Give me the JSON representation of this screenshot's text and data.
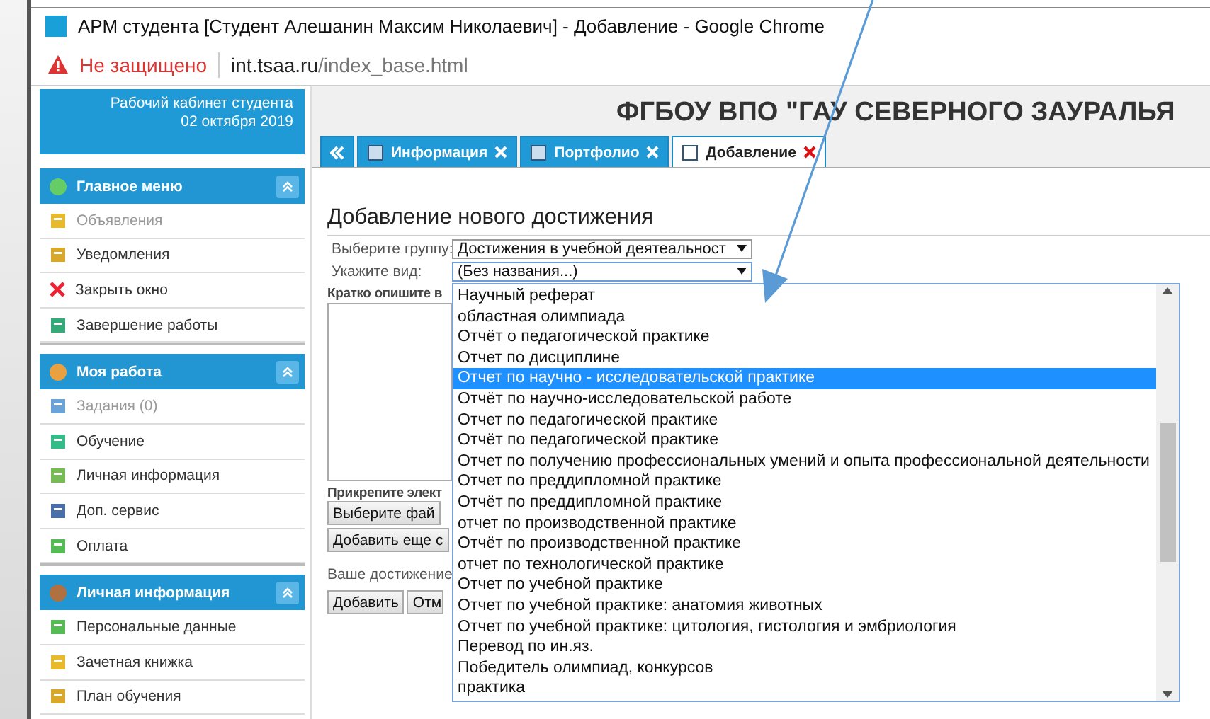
{
  "window": {
    "title": "АРМ студента [Студент Алешанин Максим Николаевич] - Добавление - Google Chrome"
  },
  "address_bar": {
    "security": "Не защищено",
    "host": "int.tsaa.ru",
    "path": "/index_base.html"
  },
  "cabinet": {
    "title": "Рабочий кабинет студента",
    "date": "02 октября 2019"
  },
  "site_title": "ФГБОУ ВПО \"ГАУ СЕВЕРНОГО ЗАУРАЛЬЯ",
  "sidebar": {
    "sections": [
      {
        "title": "Главное меню",
        "items": [
          {
            "label": "Объявления",
            "disabled": true
          },
          {
            "label": "Уведомления",
            "disabled": false
          },
          {
            "label": "Закрыть окно",
            "disabled": false
          },
          {
            "label": "Завершение работы",
            "disabled": false
          }
        ]
      },
      {
        "title": "Моя работа",
        "items": [
          {
            "label": "Задания (0)",
            "disabled": true
          },
          {
            "label": "Обучение",
            "disabled": false
          },
          {
            "label": "Личная информация",
            "disabled": false
          },
          {
            "label": "Доп. сервис",
            "disabled": false
          },
          {
            "label": "Оплата",
            "disabled": false
          }
        ]
      },
      {
        "title": "Личная информация",
        "items": [
          {
            "label": "Персональные данные",
            "disabled": false
          },
          {
            "label": "Зачетная книжка",
            "disabled": false
          },
          {
            "label": "План обучения",
            "disabled": false
          }
        ]
      }
    ]
  },
  "tabs": [
    {
      "label": "Информация",
      "selected": false
    },
    {
      "label": "Портфолио",
      "selected": false
    },
    {
      "label": "Добавление",
      "selected": true
    }
  ],
  "form": {
    "heading": "Добавление нового достижения",
    "group_label": "Выберите группу:",
    "group_value": "Достижения в учебной деятеальност",
    "kind_label": "Укажите вид:",
    "kind_value": "(Без названия...)",
    "description_label": "Кратко опишите в",
    "attach_label": "Прикрепите элект",
    "file_button": "Выберите фай",
    "add_more_button": "Добавить еще с",
    "result_label": "Ваше достижение",
    "buttons": [
      "Добавить",
      "Отм"
    ]
  },
  "dropdown": {
    "options": [
      {
        "label": "Научный реферат",
        "selected": false
      },
      {
        "label": "областная олимпиада",
        "selected": false
      },
      {
        "label": "Отчёт о педагогической практике",
        "selected": false
      },
      {
        "label": "Отчет по дисциплине",
        "selected": false
      },
      {
        "label": "Отчет по научно - исследовательской практике",
        "selected": true
      },
      {
        "label": "Отчёт по научно-исследовательской работе",
        "selected": false
      },
      {
        "label": "Отчет по педагогической практике",
        "selected": false
      },
      {
        "label": "Отчёт по педагогической практике",
        "selected": false
      },
      {
        "label": "Отчет по получению профессиональных умений и опыта профессиональной деятельности",
        "selected": false
      },
      {
        "label": "Отчет по преддипломной практике",
        "selected": false
      },
      {
        "label": "Отчёт по преддипломной практике",
        "selected": false
      },
      {
        "label": "отчет по производственной практике",
        "selected": false
      },
      {
        "label": "Отчёт по производственной практике",
        "selected": false
      },
      {
        "label": "отчет по технологической практике",
        "selected": false
      },
      {
        "label": "Отчет по учебной практике",
        "selected": false
      },
      {
        "label": "Отчет по учебной практике: анатомия животных",
        "selected": false
      },
      {
        "label": "Отчет по учебной практике: цитология, гистология и эмбриология",
        "selected": false
      },
      {
        "label": "Перевод по ин.яз.",
        "selected": false
      },
      {
        "label": "Победитель олимпиад, конкурсов",
        "selected": false
      },
      {
        "label": "практика",
        "selected": false
      }
    ]
  }
}
